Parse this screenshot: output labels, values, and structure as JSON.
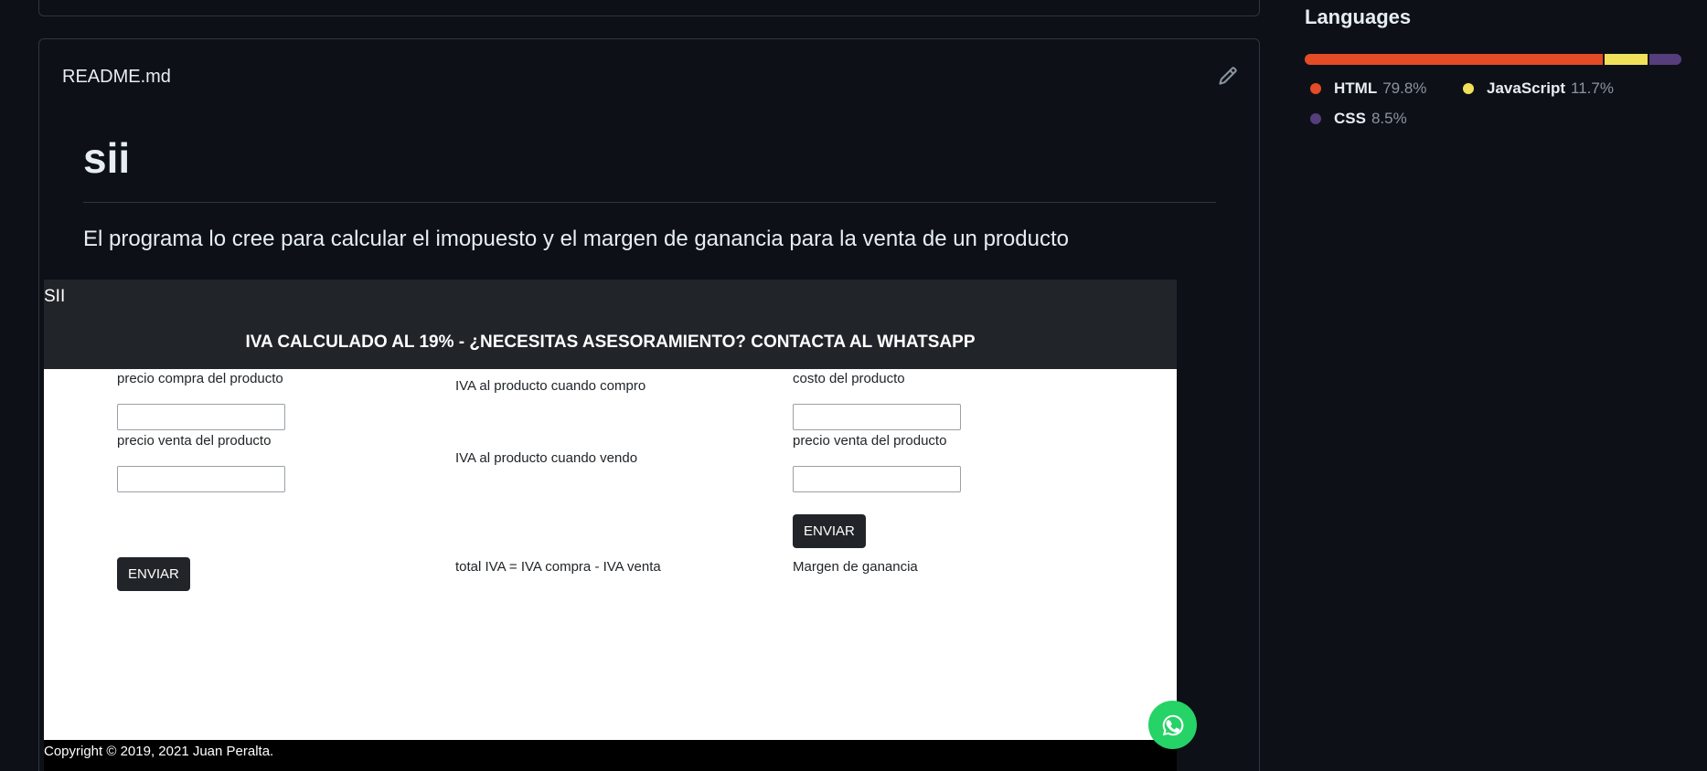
{
  "readme": {
    "filename": "README.md",
    "heading": "sii",
    "description": "El programa lo cree para calcular el imopuesto y el margen de ganancia para la venta de un producto"
  },
  "app": {
    "brand": "SII",
    "banner": "IVA CALCULADO AL 19% - ¿NECESITAS ASESORAMIENTO? CONTACTA AL WHATSAPP",
    "col1": {
      "label_buy": "precio compra del producto",
      "label_sell": "precio venta del producto",
      "button": "ENVIAR"
    },
    "col2": {
      "iva_buy": "IVA al producto cuando compro",
      "iva_sell": "IVA al producto cuando vendo",
      "total": "total IVA = IVA compra - IVA venta"
    },
    "col3": {
      "label_cost": "costo del producto",
      "label_sell": "precio venta del producto",
      "button": "ENVIAR",
      "margin": "Margen de ganancia"
    },
    "footer": "Copyright © 2019, 2021 Juan Peralta.",
    "whatsapp_icon": "whatsapp-icon"
  },
  "languages": {
    "title": "Languages",
    "items": [
      {
        "name": "HTML",
        "percent": "79.8%",
        "value": 79.8,
        "color": "#e34c26"
      },
      {
        "name": "JavaScript",
        "percent": "11.7%",
        "value": 11.7,
        "color": "#f1e05a"
      },
      {
        "name": "CSS",
        "percent": "8.5%",
        "value": 8.5,
        "color": "#563d7c"
      }
    ]
  }
}
